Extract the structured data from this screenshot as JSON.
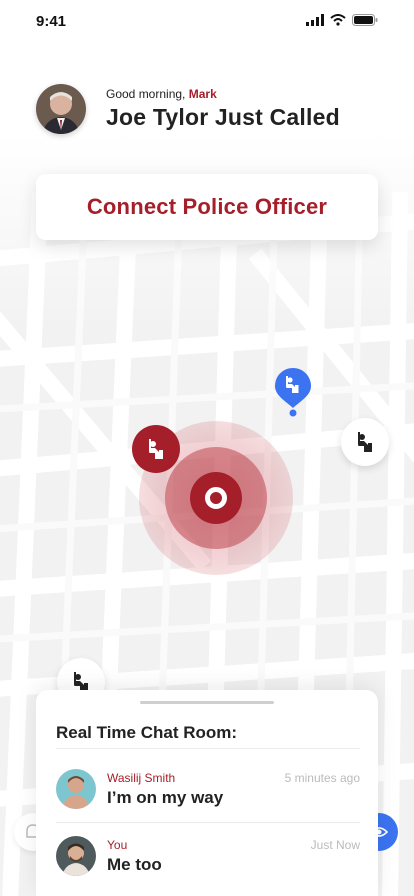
{
  "status_bar": {
    "time": "9:41"
  },
  "greeting": {
    "salutation": "Good morning,",
    "user_name": "Mark",
    "headline": "Joe Tylor Just Called"
  },
  "actions": {
    "connect_label": "Connect Police Officer"
  },
  "chat": {
    "title": "Real Time Chat Room:",
    "messages": [
      {
        "sender": "Wasilij Smith",
        "time": "5 minutes ago",
        "text": "I’m on my way"
      },
      {
        "sender": "You",
        "time": "Just Now",
        "text": "Me too"
      }
    ]
  },
  "icons": {
    "officer": "police-officer-icon",
    "location": "location-target-icon",
    "bell": "bell-icon",
    "eye": "eye-icon"
  },
  "colors": {
    "brand_red": "#a51f2a",
    "officer_blue": "#3b73f0",
    "map_background": "#f2f2f2"
  }
}
